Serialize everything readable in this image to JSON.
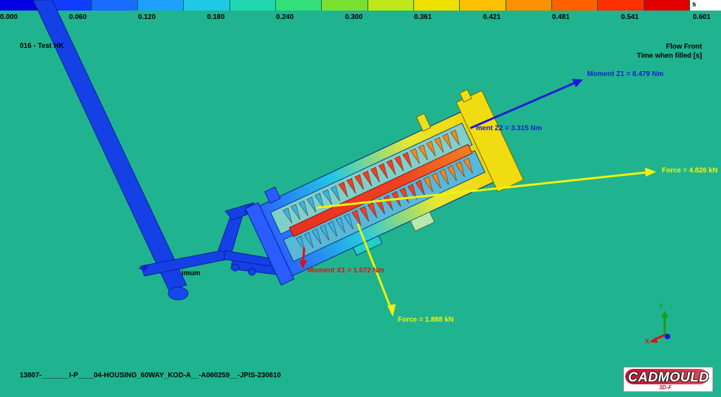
{
  "legend": {
    "unit": "s",
    "ticks": [
      "0.000",
      "0.060",
      "0.120",
      "0.180",
      "0.240",
      "0.300",
      "0.361",
      "0.421",
      "0.481",
      "0.541",
      "0.601"
    ],
    "colors": [
      "#0000e0",
      "#0f3cff",
      "#1a6cff",
      "#1ea0ff",
      "#20c8e8",
      "#1fd8b0",
      "#33e07a",
      "#7ae030",
      "#bfe81a",
      "#f0e000",
      "#ffc000",
      "#ff9000",
      "#ff6000",
      "#ff3000",
      "#e00000"
    ]
  },
  "header": {
    "project": "016 - Test HK",
    "result_title": "Flow Front",
    "result_subtitle": "Time when filled [s]"
  },
  "annotations": {
    "moment_z1": "Moment Z1 = 8.479 Nm",
    "moment_z2": "ment Z2 = 3.315 Nm",
    "force_right": "Force = 4.826 kN",
    "moment_x1": "Moment X1 = 1.672 Nm",
    "force_down": "Force = 1.888 kN",
    "minimum_fragment": "imum"
  },
  "colors": {
    "background": "#1fb48f",
    "moment_z_color": "#1a1ad6",
    "force_color": "#f2f20a",
    "moment_x_color": "#e01010"
  },
  "axes": {
    "x": "X",
    "y": "Y"
  },
  "footer": {
    "filename": "13807-_______I-P____04-HOUSING_60WAY_KOD-A__-A060259__-JPIS-230610"
  },
  "logo": {
    "main": "CADMOULD",
    "sub": "3D-F"
  }
}
